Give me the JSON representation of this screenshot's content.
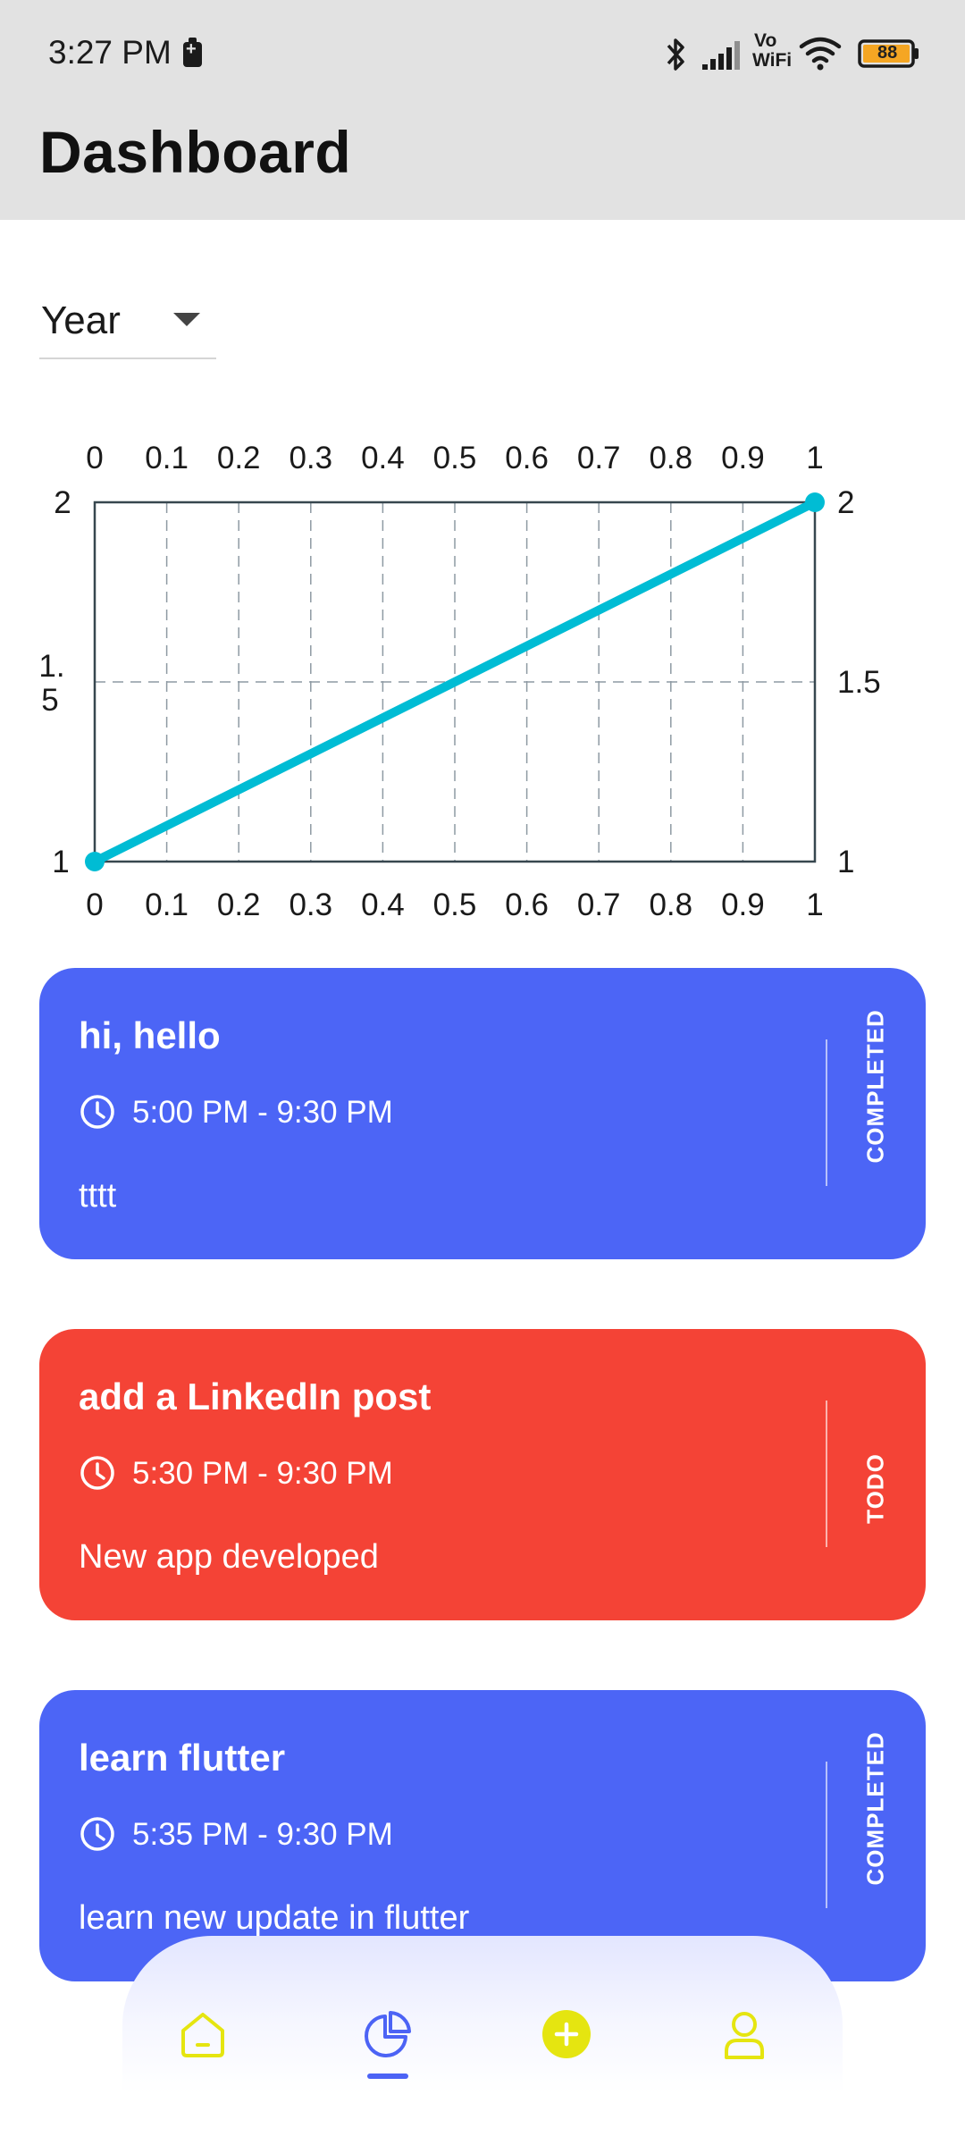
{
  "status_bar": {
    "time": "3:27 PM",
    "battery": "88",
    "icons": [
      "battery-saver-icon",
      "bluetooth-icon",
      "signal-icon",
      "vowifi-icon",
      "wifi-icon",
      "battery-icon"
    ],
    "vowifi_top": "Vo",
    "vowifi_bottom": "WiFi"
  },
  "header": {
    "title": "Dashboard"
  },
  "filter": {
    "value": "Year"
  },
  "chart_data": {
    "type": "line",
    "x": [
      0,
      1
    ],
    "y": [
      1,
      2
    ],
    "xlim": [
      0,
      1
    ],
    "ylim": [
      1,
      2
    ],
    "x_ticks": [
      "0",
      "0.1",
      "0.2",
      "0.3",
      "0.4",
      "0.5",
      "0.6",
      "0.7",
      "0.8",
      "0.9",
      "1"
    ],
    "y_ticks_left": [
      "2",
      "1.",
      "5",
      "1"
    ],
    "y_ticks_right": [
      "2",
      "1.5",
      "1"
    ],
    "grid": true,
    "line_color": "#00bcd4"
  },
  "tasks": [
    {
      "title": "hi, hello",
      "time": "5:00 PM - 9:30 PM",
      "description": "tttt",
      "status": "COMPLETED",
      "color": "#4c65f6"
    },
    {
      "title": "add a LinkedIn post",
      "time": "5:30 PM - 9:30 PM",
      "description": "New app developed",
      "status": "TODO",
      "color": "#f44336"
    },
    {
      "title": "learn flutter",
      "time": "5:35 PM - 9:30 PM",
      "description": "learn new update in flutter",
      "status": "COMPLETED",
      "color": "#4c65f6"
    }
  ],
  "bottom_nav": {
    "items": [
      "home-icon",
      "chart-icon",
      "add-icon",
      "profile-icon"
    ],
    "active": "chart-icon",
    "accent": "#e5e510",
    "active_color": "#4c63f5"
  }
}
